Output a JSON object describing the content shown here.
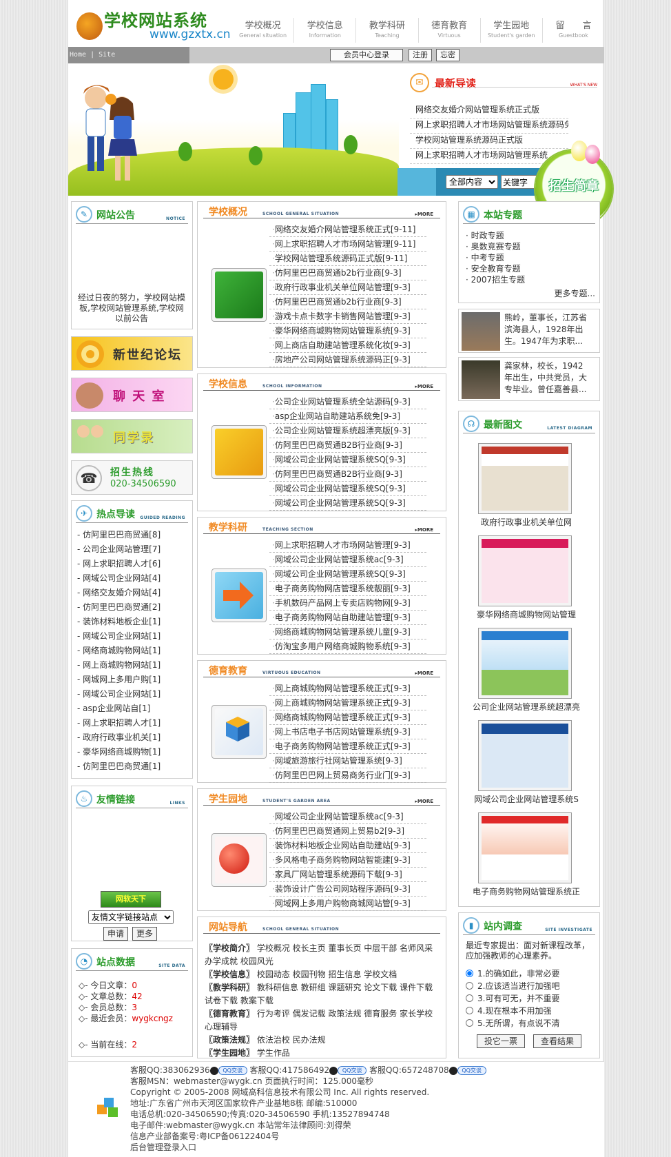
{
  "header": {
    "logo_title": "学校网站系统",
    "logo_url": "www.gzxtx.cn"
  },
  "nav": [
    {
      "cn": "学校概况",
      "en": "General situation"
    },
    {
      "cn": "学校信息",
      "en": "Information"
    },
    {
      "cn": "教学科研",
      "en": "Teaching"
    },
    {
      "cn": "德育教育",
      "en": "Virtuous"
    },
    {
      "cn": "学生园地",
      "en": "Student's garden"
    },
    {
      "cn": "留　　言",
      "en": "Guestbook"
    }
  ],
  "topbar": {
    "breadcrumb": "Home | Site",
    "member_login": "会员中心登录",
    "register": "注册",
    "forgot": "忘密"
  },
  "latest": {
    "title": "最新导读",
    "tag": "WHAT'S NEW",
    "items": [
      "网络交友婚介网站管理系统正式版",
      "网上求职招聘人才市场网站管理系统源码免费",
      "学校网站管理系统源码正式版",
      "网上求职招聘人才市场网站管理系统"
    ]
  },
  "search": {
    "scope": "全部内容",
    "keyword": "关键字"
  },
  "enroll_badge": "招生简章",
  "notice": {
    "title": "网站公告",
    "tag": "NOTICE",
    "text": "经过日夜的努力，学校网站模板,学校网站管理系统,学校网以前公告"
  },
  "promos": {
    "forum": "新世纪论坛",
    "chat": "聊 天 室",
    "classmates": "同学录",
    "hotline_title": "招生热线",
    "hotline_phone": "020-34506590"
  },
  "hot": {
    "title": "热点导读",
    "tag": "GUIDED READING",
    "items": [
      "- 仿阿里巴巴商贸通[8]",
      "- 公司企业网站管理[7]",
      "- 网上求职招聘人才[6]",
      "- 网域公司企业网站[4]",
      "- 网络交友婚介网站[4]",
      "- 仿阿里巴巴商贸通[2]",
      "- 装饰材料地板企业[1]",
      "- 网域公司企业网站[1]",
      "- 网络商城购物网站[1]",
      "- 网上商城购物网站[1]",
      "- 网城网上多用户购[1]",
      "- 网域公司企业网站[1]",
      "- asp企业网站自[1]",
      "- 网上求职招聘人才[1]",
      "- 政府行政事业机关[1]",
      "- 豪华网络商城购物[1]",
      "- 仿阿里巴巴商贸通[1]"
    ]
  },
  "links": {
    "title": "友情链接",
    "tag": "LINKS",
    "banner": "网软天下",
    "select": "友情文字链接站点",
    "apply": "申请",
    "more": "更多"
  },
  "site_stats": {
    "title": "站点数据",
    "tag": "SITE DATA",
    "today_label": "◇- 今日文章：",
    "today": "0",
    "total_label": "◇- 文章总数：",
    "total": "42",
    "members_label": "◇- 会员总数：",
    "members": "3",
    "newest_label": "◇- 最近会员：",
    "newest": "wygkcngz",
    "online_label": "◇- 当前在线：",
    "online": "2"
  },
  "sections": [
    {
      "title": "学校概况",
      "tag": "SCHOOL GENERAL SITUATION",
      "more": "MORE",
      "items": [
        "网络交友婚介网站管理系统正式[9-11]",
        "网上求职招聘人才市场网站管理[9-11]",
        "学校网站管理系统源码正式版[9-11]",
        "仿阿里巴巴商贸通b2b行业商[9-3]",
        "政府行政事业机关单位网站管理[9-3]",
        "仿阿里巴巴商贸通b2b行业商[9-3]",
        "游戏卡点卡数字卡销售网站管理[9-3]",
        "豪华网络商城购物网站管理系统[9-3]",
        "网上商店自助建站管理系统化妆[9-3]",
        "房地产公司网站管理系统源码正[9-3]"
      ]
    },
    {
      "title": "学校信息",
      "tag": "SCHOOL INFORMATION",
      "more": "MORE",
      "items": [
        "公司企业网站管理系统全站源码[9-3]",
        "asp企业网站自助建站系统免[9-3]",
        "公司企业网站管理系统超漂亮版[9-3]",
        "仿阿里巴巴商贸通B2B行业商[9-3]",
        "网域公司企业网站管理系统SQ[9-3]",
        "仿阿里巴巴商贸通B2B行业商[9-3]",
        "网域公司企业网站管理系统SQ[9-3]",
        "网域公司企业网站管理系统SQ[9-3]"
      ]
    },
    {
      "title": "教学科研",
      "tag": "TEACHING SECTION",
      "more": "MORE",
      "items": [
        "网上求职招聘人才市场网站管理[9-3]",
        "网域公司企业网站管理系统ac[9-3]",
        "网域公司企业网站管理系统SQ[9-3]",
        "电子商务购物网店管理系统靓丽[9-3]",
        "手机数码产品网上专卖店购物网[9-3]",
        "电子商务购物网站自助建站管理[9-3]",
        "网络商城购物网站管理系统儿童[9-3]",
        "仿淘宝多用户网络商城购物系统[9-3]"
      ]
    },
    {
      "title": "德育教育",
      "tag": "VIRTUOUS EDUCATION",
      "more": "MORE",
      "items": [
        "网上商城购物网站管理系统正式[9-3]",
        "网上商城购物网站管理系统正式[9-3]",
        "网络商城购物网站管理系统正式[9-3]",
        "网上书店电子书店网站管理系统[9-3]",
        "电子商务购物网站管理系统正式[9-3]",
        "网域旅游旅行社网站管理系统[9-3]",
        "仿阿里巴巴网上贸易商务行业门[9-3]"
      ]
    },
    {
      "title": "学生园地",
      "tag": "STUDENT'S GARDEN AREA",
      "more": "MORE",
      "items": [
        "网域公司企业网站管理系统ac[9-3]",
        "仿阿里巴巴商贸通网上贸易b2[9-3]",
        "装饰材料地板企业网站自助建站[9-3]",
        "多风格电子商务购物网站智能建[9-3]",
        "家具厂网站管理系统源码下载[9-3]",
        "装饰设计广告公司网站程序源码[9-3]",
        "网域网上多用户购物商城网站管[9-3]"
      ]
    }
  ],
  "sitenav": {
    "title": "网站导航",
    "tag": "SCHOOL GENERAL SITUATION",
    "rows": [
      {
        "k": "〖学校简介〗",
        "v": " 学校概况  校长主页  董事长页  中层干部  名师风采  办学成就  校园风光"
      },
      {
        "k": "〖学校信息〗",
        "v": " 校园动态  校园刊物  招生信息  学校文档"
      },
      {
        "k": "〖教学科研〗",
        "v": " 教科研信息  教研组  课题研究  论文下载  课件下载  试卷下载  教案下载"
      },
      {
        "k": "〖德育教育〗",
        "v": " 行为考评  偶发记载  政策法规  德育服务  家长学校  心理辅导"
      },
      {
        "k": "〖政策法规〗",
        "v": " 依法治校  民办法规"
      },
      {
        "k": "〖学生园地〗",
        "v": " 学生作品"
      }
    ]
  },
  "topics": {
    "title": "本站专题",
    "items": [
      "· 时政专题",
      "· 奥数竞赛专题",
      "· 中考专题",
      "· 安全教育专题",
      "· 2007招生专题"
    ],
    "more": "更多专题..."
  },
  "people": [
    {
      "text": "熊岭，董事长，江苏省滨海县人，1928年出生。1947年为求职..."
    },
    {
      "text": "龚家林，校长，1942年出生，中共党员，大专毕业。曾任嘉善县..."
    }
  ],
  "gallery": {
    "title": "最新图文",
    "tag": "LATEST DIAGRAM",
    "captions": [
      "政府行政事业机关单位网",
      "豪华网络商城购物网站管理",
      "公司企业网站管理系统超漂亮",
      "网域公司企业网站管理系统S",
      "电子商务购物网站管理系统正"
    ]
  },
  "poll": {
    "title": "站内调查",
    "tag": "SITE INVESTIGATE",
    "question": "最近专家提出：面对新课程改革，应加强教师的心理素养。",
    "options": [
      "1.的确如此，非常必要",
      "2.应该适当进行加强吧",
      "3.可有可无，并不重要",
      "4.现在根本不用加强",
      "5.无所谓，有点说不清"
    ],
    "vote": "投它一票",
    "results": "查看结果"
  },
  "footer": {
    "qq1": "客服QQ:383062936",
    "qq2": "客服QQ:417586492",
    "qq3": "客服QQ:657248708",
    "qq_btn": "QQ交谈",
    "msn": "客服MSN：webmaster@wygk.cn 页面执行时间：125.000毫秒",
    "copyright": "Copyright © 2005-2008 网域高科信息技术有限公司 Inc. All rights reserved.",
    "address": "地址:广东省广州市天河区国家软件产业基地8栋 邮编:510000",
    "phone": "电话总机:020-34506590;传真:020-34506590 手机:13527894748",
    "email": "电子邮件:webmaster@wygk.cn 本站常年法律顾问:刘得荣",
    "icp": "信息产业部备案号:粤ICP备06122404号",
    "admin": "后台管理登录入口"
  }
}
